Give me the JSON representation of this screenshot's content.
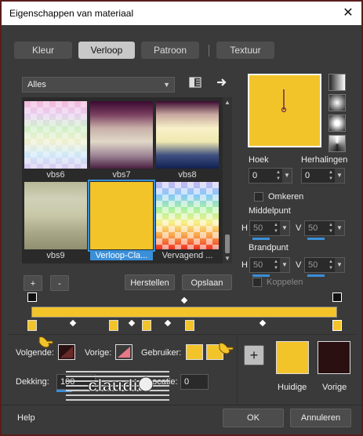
{
  "window": {
    "title": "Eigenschappen van materiaal",
    "close_label": "✕"
  },
  "tabs": [
    {
      "label": "Kleur",
      "active": false
    },
    {
      "label": "Verloop",
      "active": true
    },
    {
      "label": "Patroon",
      "active": false
    },
    {
      "label": "Textuur",
      "active": false
    }
  ],
  "category": {
    "selected": "Alles"
  },
  "library": {
    "items": [
      {
        "label": "vbs6",
        "selected": false
      },
      {
        "label": "vbs7",
        "selected": false
      },
      {
        "label": "vbs8",
        "selected": false
      },
      {
        "label": "vbs9",
        "selected": false
      },
      {
        "label": "Verloop-Cla...",
        "selected": true
      },
      {
        "label": "Vervagend ...",
        "selected": false
      }
    ]
  },
  "library_buttons": {
    "add": "+",
    "remove": "-",
    "reset": "Herstellen",
    "save": "Opslaan"
  },
  "controls": {
    "angle_label": "Hoek",
    "angle_value": "0",
    "repeats_label": "Herhalingen",
    "repeats_value": "0",
    "invert_label": "Omkeren",
    "midpoint_label": "Middelpunt",
    "focus_label": "Brandpunt",
    "h_label": "H",
    "v_label": "V",
    "mid_h": "50",
    "mid_v": "50",
    "focus_h": "50",
    "focus_v": "50",
    "link_label": "Koppelen"
  },
  "stops": {
    "next_label": "Volgende:",
    "prev_label": "Vorige:",
    "user_label": "Gebruiker:",
    "opacity_label": "Dekking:",
    "opacity_value": "100",
    "location_label": "Locatie:",
    "location_value": "0"
  },
  "current": {
    "label": "Huidige",
    "color": "#f2c42a"
  },
  "previous": {
    "label": "Vorige",
    "color": "#2a1010"
  },
  "footer": {
    "help": "Help",
    "ok": "OK",
    "cancel": "Annuleren"
  },
  "watermark": {
    "text": "claudia"
  },
  "colors": {
    "gradient": "#f2c42a",
    "accent": "#3a8fd8",
    "frame": "#5a1c1c"
  }
}
